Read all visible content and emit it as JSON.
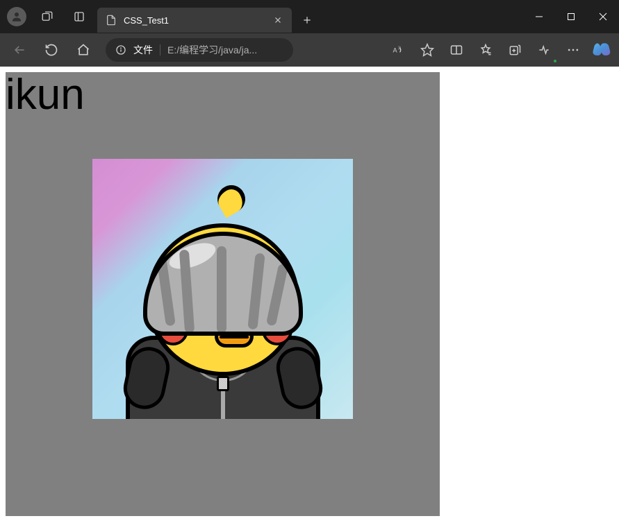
{
  "tab": {
    "title": "CSS_Test1"
  },
  "url": {
    "prefix": "文件",
    "path": "E:/编程学习/java/ja..."
  },
  "page": {
    "heading": "ikun"
  }
}
